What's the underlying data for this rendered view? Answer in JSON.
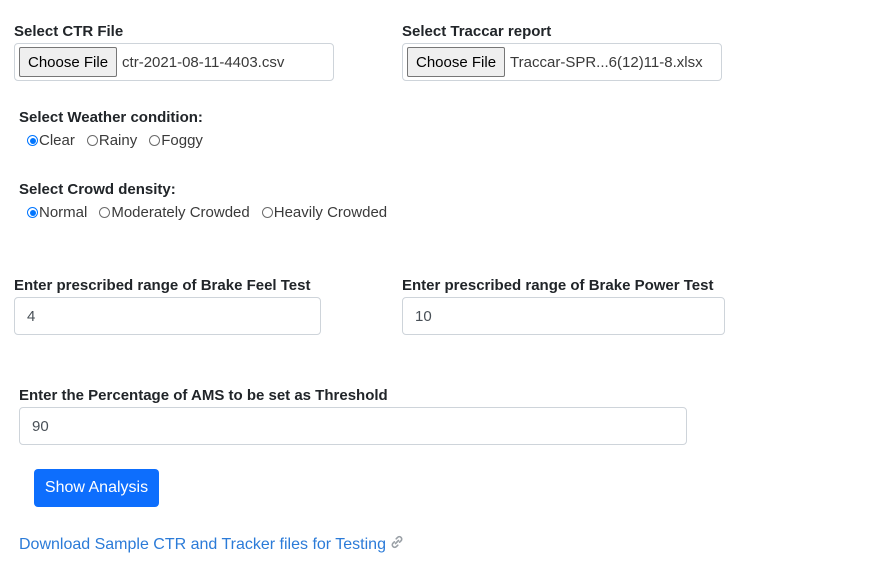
{
  "ctr_file": {
    "label": "Select CTR File",
    "button": "Choose File",
    "filename": "ctr-2021-08-11-4403.csv"
  },
  "traccar_file": {
    "label": "Select Traccar report",
    "button": "Choose File",
    "filename": "Traccar-SPR...6(12)11-8.xlsx"
  },
  "weather": {
    "label": "Select Weather condition:",
    "options": [
      "Clear",
      "Rainy",
      "Foggy"
    ],
    "selected": "Clear"
  },
  "crowd": {
    "label": "Select Crowd density:",
    "options": [
      "Normal",
      "Moderately Crowded",
      "Heavily Crowded"
    ],
    "selected": "Normal"
  },
  "brake_feel": {
    "label": "Enter prescribed range of Brake Feel Test",
    "value": "4"
  },
  "brake_power": {
    "label": "Enter prescribed range of Brake Power Test",
    "value": "10"
  },
  "ams": {
    "label": "Enter the Percentage of AMS to be set as Threshold",
    "value": "90"
  },
  "show_analysis": {
    "label": "Show Analysis"
  },
  "download_link": {
    "label": "Download Sample CTR and Tracker files for Testing",
    "icon": "link-icon"
  },
  "colors": {
    "primary": "#0d6efd",
    "link": "#2b7bd8",
    "radio_checked": "#0075ff"
  }
}
